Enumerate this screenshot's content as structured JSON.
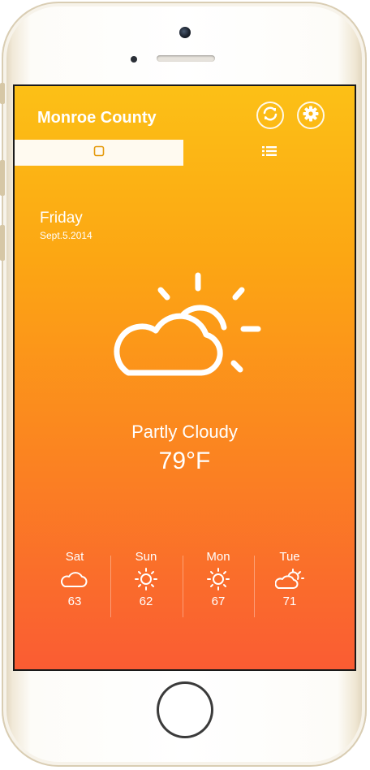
{
  "header": {
    "title": "Monroe County",
    "refresh_icon": "refresh-icon",
    "settings_icon": "gear-icon"
  },
  "tabs": [
    {
      "icon": "square-icon",
      "active": true
    },
    {
      "icon": "list-icon",
      "active": false
    }
  ],
  "current": {
    "day": "Friday",
    "date": "Sept.5.2014",
    "icon": "partly-cloudy-icon",
    "condition": "Partly Cloudy",
    "temperature": "79°F"
  },
  "forecast": [
    {
      "day": "Sat",
      "icon": "cloud-icon",
      "temp": "63"
    },
    {
      "day": "Sun",
      "icon": "sun-icon",
      "temp": "62"
    },
    {
      "day": "Mon",
      "icon": "sun-icon",
      "temp": "67"
    },
    {
      "day": "Tue",
      "icon": "partly-cloudy-icon",
      "temp": "71"
    }
  ],
  "colors": {
    "gradient_top": "#fcc016",
    "gradient_bottom": "#fa5c33",
    "text": "#ffffff",
    "tab_active_bg": "#fffaf0"
  }
}
